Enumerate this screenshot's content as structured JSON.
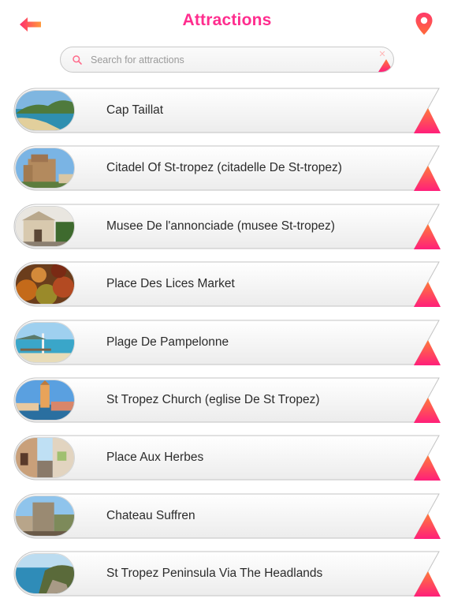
{
  "header": {
    "title": "Attractions",
    "back_icon": "back-arrow-icon",
    "location_icon": "map-pin-icon"
  },
  "search": {
    "placeholder": "Search for attractions",
    "value": ""
  },
  "colors": {
    "accent_pink": "#ff2d8e",
    "accent_orange": "#ff8a3d",
    "row_text": "#2b2b2b"
  },
  "attractions": [
    {
      "name": "Cap Taillat",
      "thumbnail": "coastal-headland-photo"
    },
    {
      "name": "Citadel Of St-tropez (citadelle De St-tropez)",
      "thumbnail": "citadel-fortress-photo"
    },
    {
      "name": "Musee De l'annonciade (musee St-tropez)",
      "thumbnail": "museum-building-photo"
    },
    {
      "name": "Place Des Lices Market",
      "thumbnail": "market-spices-photo"
    },
    {
      "name": "Plage De Pampelonne",
      "thumbnail": "beach-pier-photo"
    },
    {
      "name": "St Tropez Church (eglise De St Tropez)",
      "thumbnail": "church-bell-tower-photo"
    },
    {
      "name": "Place Aux Herbes",
      "thumbnail": "narrow-street-photo"
    },
    {
      "name": "Chateau Suffren",
      "thumbnail": "stone-tower-photo"
    },
    {
      "name": "St Tropez Peninsula Via The Headlands",
      "thumbnail": "rocky-shore-photo"
    }
  ]
}
